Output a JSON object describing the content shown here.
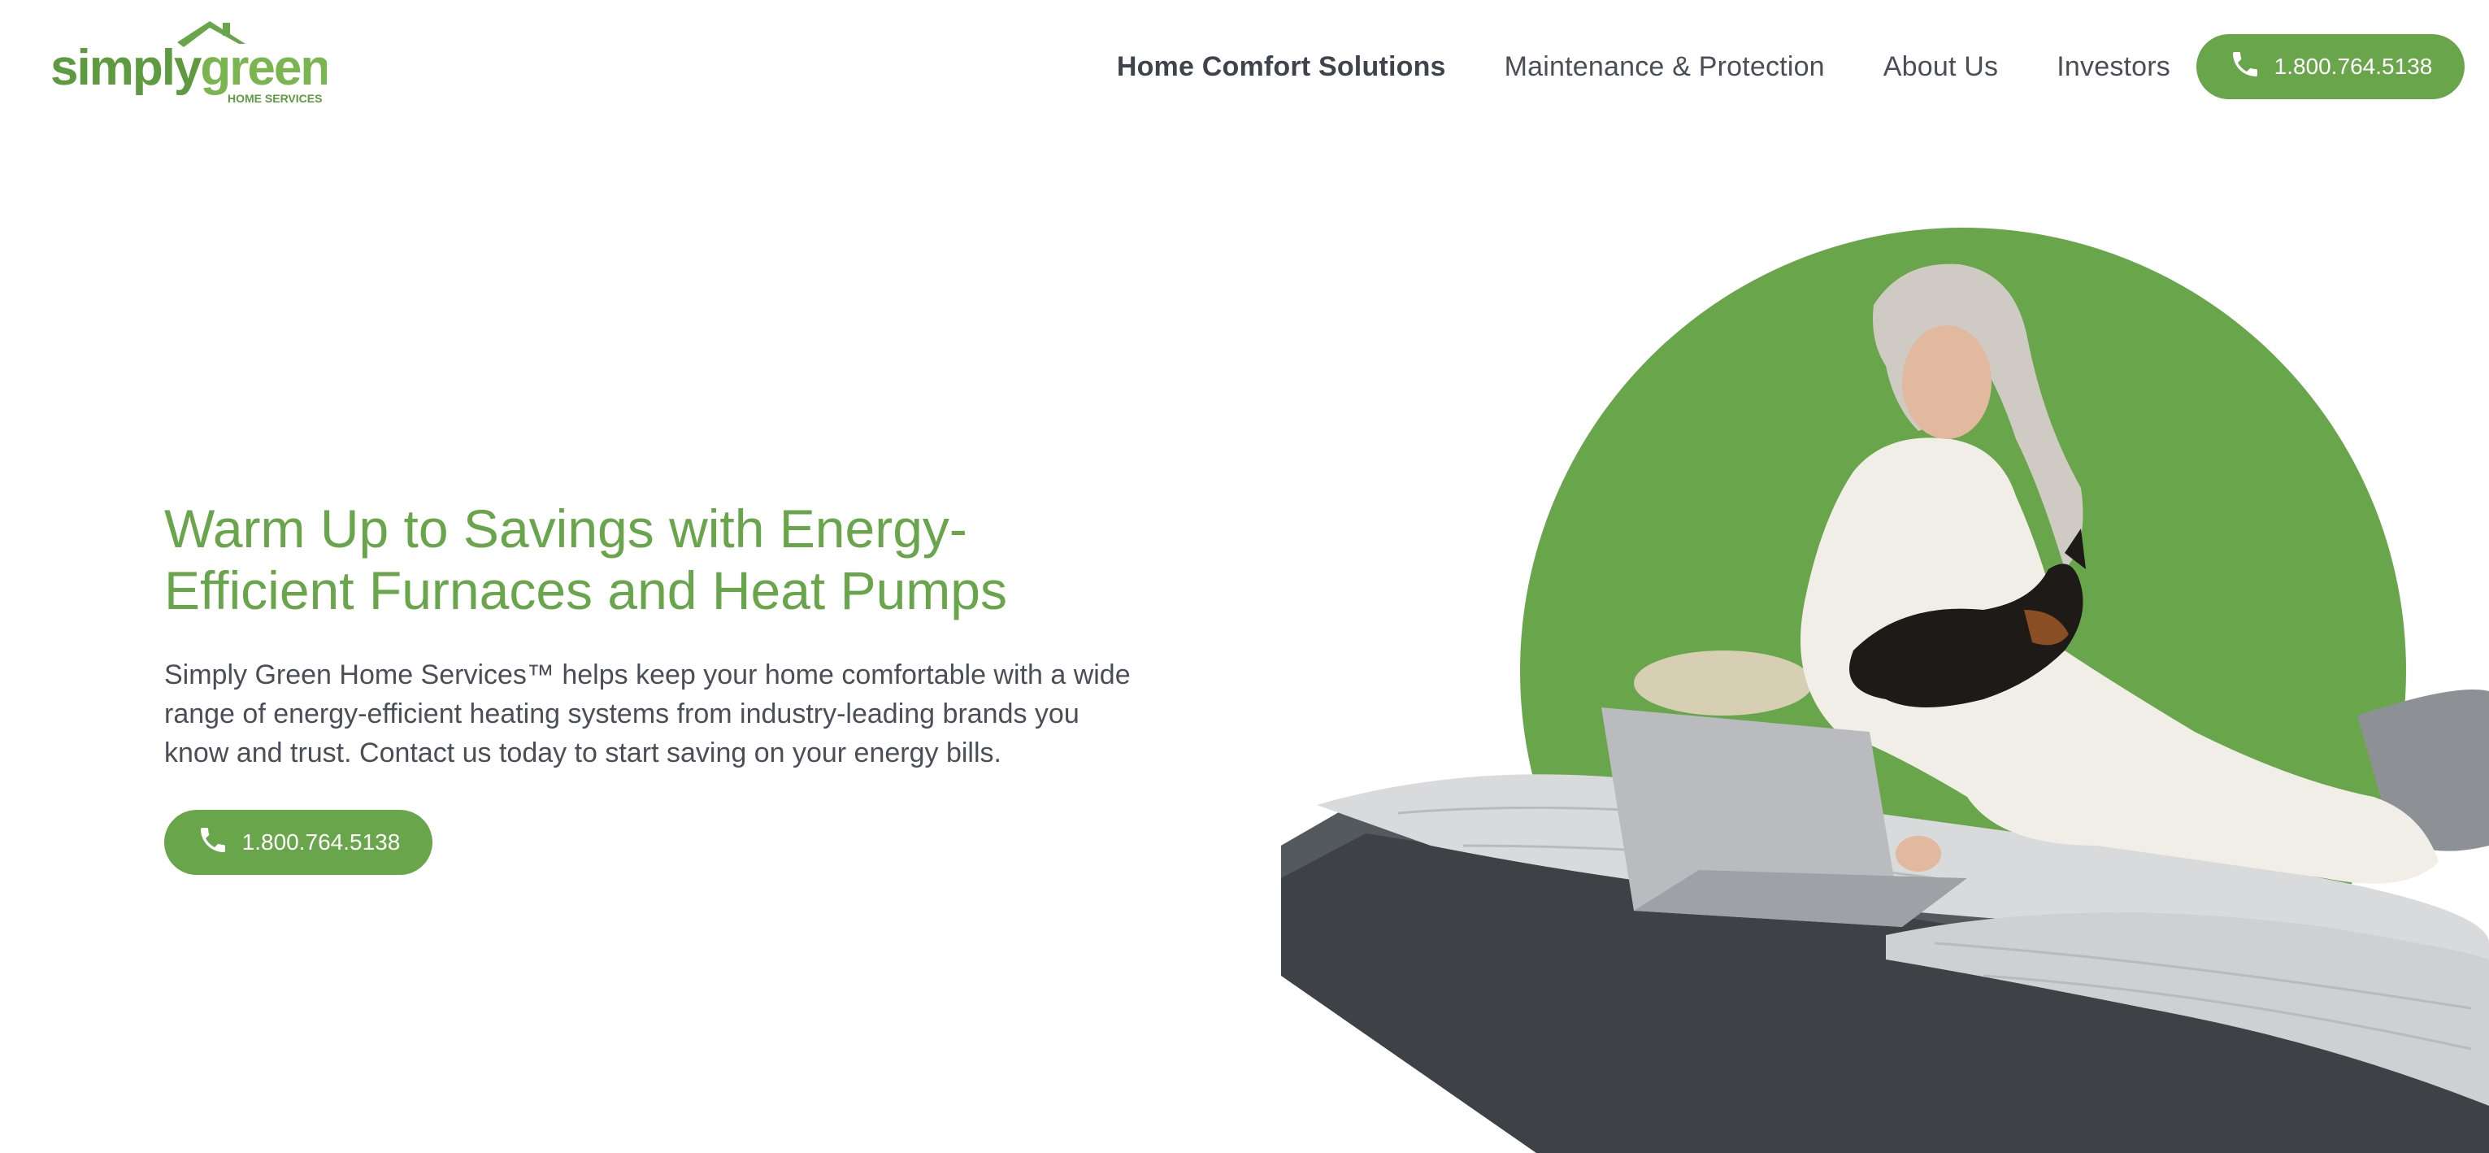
{
  "brand": {
    "logo_main": "simplygreen",
    "logo_word1": "simply",
    "logo_word2": "green",
    "logo_sub": "HOME SERVICES",
    "accent_color": "#69a54b",
    "text_color": "#4a4f57"
  },
  "nav": {
    "items": [
      {
        "label": "Home Comfort Solutions",
        "active": true
      },
      {
        "label": "Maintenance & Protection",
        "active": false
      },
      {
        "label": "About Us",
        "active": false
      },
      {
        "label": "Investors",
        "active": false
      }
    ],
    "phone": {
      "label": "1.800.764.5138",
      "icon": "phone-icon"
    }
  },
  "hero": {
    "title_line1": "Warm Up to Savings with Energy-",
    "title_line2": "Efficient Furnaces and Heat Pumps",
    "body_line1": "Simply Green Home Services™ helps keep your home comfortable with a wide",
    "body_line2": "range of energy-efficient heating systems from industry-leading brands you",
    "body_line3": "know and trust. Contact us today to start saving on your energy bills.",
    "phone": {
      "label": "1.800.764.5138",
      "icon": "phone-icon"
    },
    "image": {
      "icon": "hero-photo-woman-with-dog-and-laptop"
    }
  }
}
